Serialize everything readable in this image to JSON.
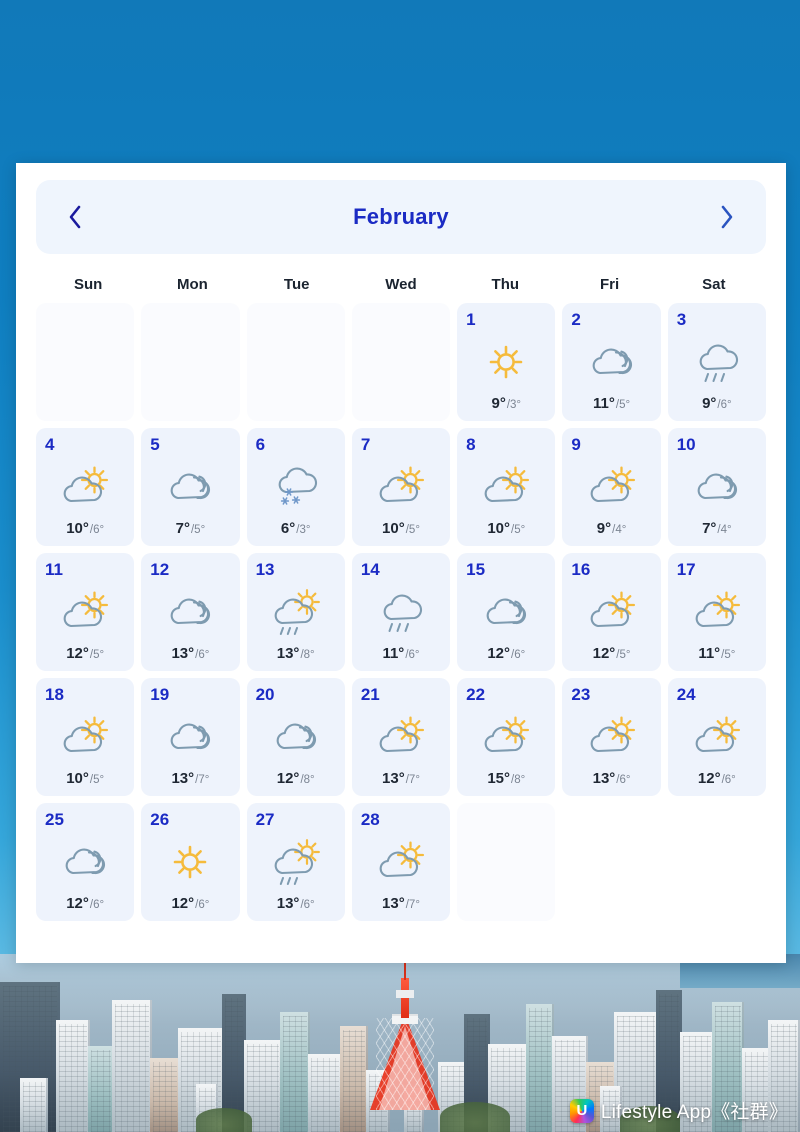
{
  "background": {
    "sky_gradient_top": "#1179b9",
    "sky_gradient_bottom": "#9fd6ee",
    "photo_caption": "Tokyo cityscape with Tokyo Tower"
  },
  "watermark": {
    "logo_icon": "u-logo-icon",
    "logo_letter": "U",
    "text": "Lifestyle App《社群》"
  },
  "header": {
    "prev_icon": "chevron-left-icon",
    "next_icon": "chevron-right-icon",
    "month": "February",
    "month_color": "#1b2bc4"
  },
  "weekdays": [
    "Sun",
    "Mon",
    "Tue",
    "Wed",
    "Thu",
    "Fri",
    "Sat"
  ],
  "legend": {
    "sun": "sun-icon",
    "cloudy": "cloudy-icon",
    "partly_sunny": "partly-sunny-icon",
    "rain": "rain-icon",
    "sun_rain": "sun-rain-icon",
    "snow": "snow-icon"
  },
  "calendar": {
    "leading_blanks": 4,
    "trailing_blanks": 1,
    "days": [
      {
        "day": "1",
        "weekday": "Thu",
        "icon": "sun",
        "high": "9°",
        "low": "/3°"
      },
      {
        "day": "2",
        "weekday": "Fri",
        "icon": "cloudy",
        "high": "11°",
        "low": "/5°"
      },
      {
        "day": "3",
        "weekday": "Sat",
        "icon": "rain",
        "high": "9°",
        "low": "/6°"
      },
      {
        "day": "4",
        "weekday": "Sun",
        "icon": "partly_sunny",
        "high": "10°",
        "low": "/6°"
      },
      {
        "day": "5",
        "weekday": "Mon",
        "icon": "cloudy",
        "high": "7°",
        "low": "/5°"
      },
      {
        "day": "6",
        "weekday": "Tue",
        "icon": "snow",
        "high": "6°",
        "low": "/3°"
      },
      {
        "day": "7",
        "weekday": "Wed",
        "icon": "partly_sunny",
        "high": "10°",
        "low": "/5°"
      },
      {
        "day": "8",
        "weekday": "Thu",
        "icon": "partly_sunny",
        "high": "10°",
        "low": "/5°"
      },
      {
        "day": "9",
        "weekday": "Fri",
        "icon": "partly_sunny",
        "high": "9°",
        "low": "/4°"
      },
      {
        "day": "10",
        "weekday": "Sat",
        "icon": "cloudy",
        "high": "7°",
        "low": "/4°"
      },
      {
        "day": "11",
        "weekday": "Sun",
        "icon": "partly_sunny",
        "high": "12°",
        "low": "/5°"
      },
      {
        "day": "12",
        "weekday": "Mon",
        "icon": "cloudy",
        "high": "13°",
        "low": "/6°"
      },
      {
        "day": "13",
        "weekday": "Tue",
        "icon": "sun_rain",
        "high": "13°",
        "low": "/8°"
      },
      {
        "day": "14",
        "weekday": "Wed",
        "icon": "rain",
        "high": "11°",
        "low": "/6°"
      },
      {
        "day": "15",
        "weekday": "Thu",
        "icon": "cloudy",
        "high": "12°",
        "low": "/6°"
      },
      {
        "day": "16",
        "weekday": "Fri",
        "icon": "partly_sunny",
        "high": "12°",
        "low": "/5°"
      },
      {
        "day": "17",
        "weekday": "Sat",
        "icon": "partly_sunny",
        "high": "11°",
        "low": "/5°"
      },
      {
        "day": "18",
        "weekday": "Sun",
        "icon": "partly_sunny",
        "high": "10°",
        "low": "/5°"
      },
      {
        "day": "19",
        "weekday": "Mon",
        "icon": "cloudy",
        "high": "13°",
        "low": "/7°"
      },
      {
        "day": "20",
        "weekday": "Tue",
        "icon": "cloudy",
        "high": "12°",
        "low": "/8°"
      },
      {
        "day": "21",
        "weekday": "Wed",
        "icon": "partly_sunny",
        "high": "13°",
        "low": "/7°"
      },
      {
        "day": "22",
        "weekday": "Thu",
        "icon": "partly_sunny",
        "high": "15°",
        "low": "/8°"
      },
      {
        "day": "23",
        "weekday": "Fri",
        "icon": "partly_sunny",
        "high": "13°",
        "low": "/6°"
      },
      {
        "day": "24",
        "weekday": "Sat",
        "icon": "partly_sunny",
        "high": "12°",
        "low": "/6°"
      },
      {
        "day": "25",
        "weekday": "Sun",
        "icon": "cloudy",
        "high": "12°",
        "low": "/6°"
      },
      {
        "day": "26",
        "weekday": "Mon",
        "icon": "sun",
        "high": "12°",
        "low": "/6°"
      },
      {
        "day": "27",
        "weekday": "Tue",
        "icon": "sun_rain",
        "high": "13°",
        "low": "/6°"
      },
      {
        "day": "28",
        "weekday": "Wed",
        "icon": "partly_sunny",
        "high": "13°",
        "low": "/7°"
      }
    ]
  },
  "colors": {
    "card_bg": "#ffffff",
    "cell_bg": "#eef3fc",
    "empty_cell_bg": "#fafbfe",
    "month_bar_bg": "#eff5fd",
    "day_number": "#1b2bc4",
    "high_temp": "#1f2733",
    "low_temp": "#7b8492",
    "cloud_stroke": "#7e9bb0",
    "sun_fill": "#f5bb3c",
    "snow_fill": "#6f97c9"
  }
}
